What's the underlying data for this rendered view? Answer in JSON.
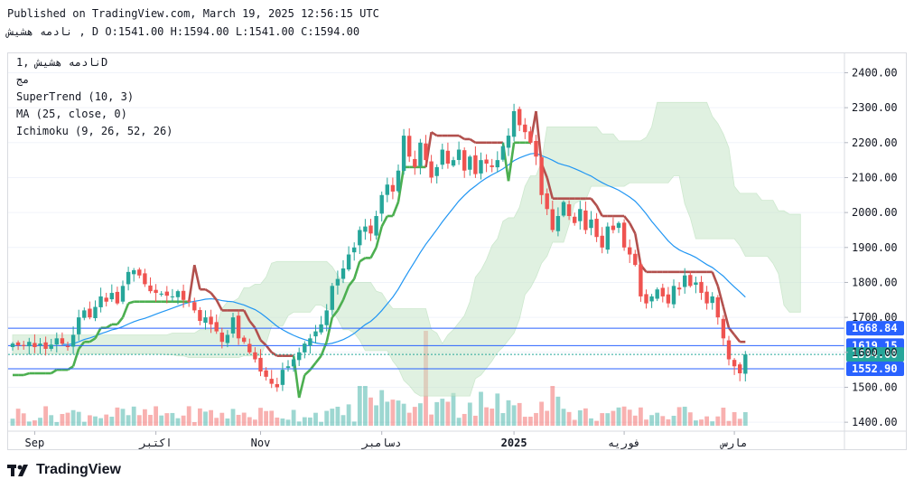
{
  "header": {
    "published": "Published on TradingView.com, March 19, 2025 12:56:15 UTC",
    "ohlc_line": "نادمه هشيش , D O:1541.00 H:1594.00 L:1541.00 C:1594.00"
  },
  "legend": {
    "symbol_line": "نادمه هشيش ,1D",
    "exchange_line": "مج",
    "supertrend": "SuperTrend (10, 3)",
    "ma": "MA (25, close, 0)",
    "ichimoku": "Ichimoku (9, 26, 52, 26)"
  },
  "footer": {
    "brand": "TradingView"
  },
  "colors": {
    "up": "#26a69a",
    "down": "#ef5350",
    "supertrend_up": "#4caf50",
    "supertrend_down": "#b2504d",
    "ma": "#2196f3",
    "cloud_bull": "#c8e6c9",
    "cloud_bear": "#f8d7d7",
    "price_line": "#2962ff"
  },
  "chart_data": {
    "type": "candlestick",
    "title": "",
    "xlabel": "",
    "ylabel": "",
    "ylim": [
      1390,
      2440
    ],
    "y_ticks": [
      1400,
      1500,
      1600,
      1700,
      1800,
      1900,
      2000,
      2100,
      2200,
      2300,
      2400
    ],
    "y_tick_labels": [
      "1400.00",
      "1500.00",
      "1600.00",
      "1700.00",
      "1800.00",
      "1900.00",
      "2000.00",
      "2100.00",
      "2200.00",
      "2300.00",
      "2400.00"
    ],
    "x_tick_labels": [
      {
        "label": "Sep",
        "index": 4
      },
      {
        "label": "اکتبر",
        "index": 26
      },
      {
        "label": "Nov",
        "index": 45
      },
      {
        "label": "دسامبر",
        "index": 67
      },
      {
        "label": "2025",
        "index": 91
      },
      {
        "label": "فوریه",
        "index": 111
      },
      {
        "label": "مارس",
        "index": 131
      }
    ],
    "price_levels": [
      {
        "label": "1668.84",
        "value": 1668.84,
        "color": "#2962ff"
      },
      {
        "label": "1619.15",
        "value": 1619.15,
        "color": "#2962ff"
      },
      {
        "label": "1594.00",
        "value": 1594.0,
        "color": "#26a69a"
      },
      {
        "label": "1552.90",
        "value": 1552.9,
        "color": "#2962ff"
      }
    ],
    "current_price": 1594.0,
    "close": [
      1625,
      1620,
      1618,
      1630,
      1615,
      1625,
      1610,
      1622,
      1640,
      1625,
      1615,
      1650,
      1700,
      1720,
      1700,
      1730,
      1760,
      1745,
      1770,
      1740,
      1790,
      1830,
      1835,
      1820,
      1795,
      1775,
      1770,
      1768,
      1762,
      1760,
      1775,
      1750,
      1745,
      1720,
      1690,
      1700,
      1680,
      1660,
      1630,
      1650,
      1700,
      1640,
      1630,
      1600,
      1580,
      1545,
      1530,
      1510,
      1500,
      1550,
      1560,
      1580,
      1600,
      1625,
      1640,
      1660,
      1680,
      1720,
      1790,
      1810,
      1840,
      1880,
      1900,
      1950,
      1960,
      1940,
      1990,
      2050,
      2080,
      2060,
      2120,
      2220,
      2160,
      2130,
      2200,
      2150,
      2100,
      2130,
      2180,
      2140,
      2150,
      2180,
      2120,
      2160,
      2110,
      2150,
      2140,
      2130,
      2150,
      2190,
      2220,
      2290,
      2250,
      2230,
      2200,
      2160,
      2050,
      2010,
      1950,
      1990,
      2030,
      1990,
      1970,
      2010,
      1950,
      1980,
      1930,
      1900,
      1960,
      1950,
      1970,
      1900,
      1880,
      1850,
      1760,
      1740,
      1760,
      1780,
      1760,
      1740,
      1790,
      1780,
      1820,
      1790,
      1800,
      1770,
      1740,
      1760,
      1700,
      1640,
      1580,
      1560,
      1540,
      1594
    ]
  }
}
